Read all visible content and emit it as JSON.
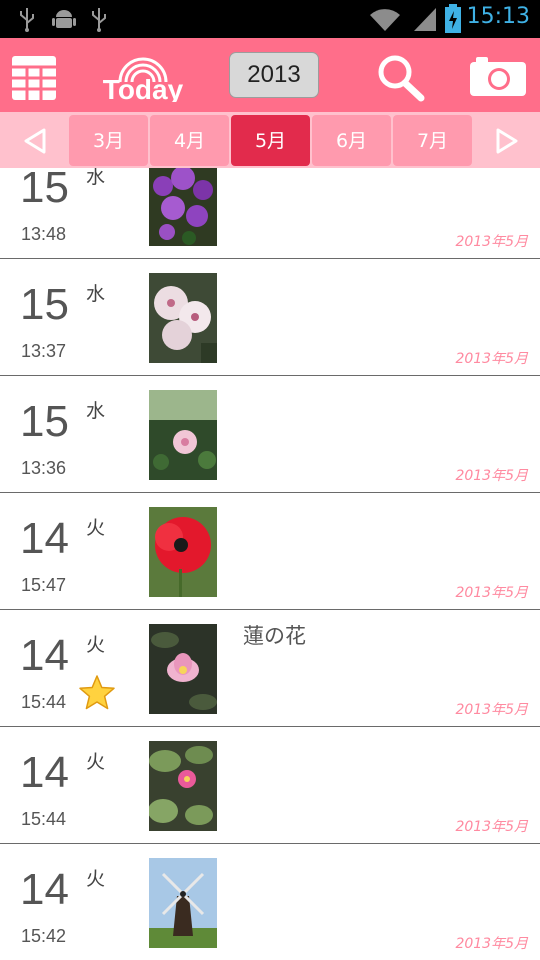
{
  "status_bar": {
    "time": "15:13"
  },
  "header": {
    "year": "2013",
    "logo_text": "Today"
  },
  "months": {
    "tabs": [
      "3月",
      "4月",
      "5月",
      "6月",
      "7月"
    ],
    "active_index": 2
  },
  "entries": [
    {
      "day": "15",
      "weekday": "水",
      "time": "13:48",
      "memo": "",
      "month_label": "2013年5月",
      "starred": false,
      "photo": "purple-flowers-photo"
    },
    {
      "day": "15",
      "weekday": "水",
      "time": "13:37",
      "memo": "",
      "month_label": "2013年5月",
      "starred": false,
      "photo": "white-rhododendron-photo"
    },
    {
      "day": "15",
      "weekday": "水",
      "time": "13:36",
      "memo": "",
      "month_label": "2013年5月",
      "starred": false,
      "photo": "pink-flower-photo"
    },
    {
      "day": "14",
      "weekday": "火",
      "time": "15:47",
      "memo": "",
      "month_label": "2013年5月",
      "starred": false,
      "photo": "red-poppy-photo"
    },
    {
      "day": "14",
      "weekday": "火",
      "time": "15:44",
      "memo": "蓮の花",
      "month_label": "2013年5月",
      "starred": true,
      "photo": "lotus-flower-photo"
    },
    {
      "day": "14",
      "weekday": "火",
      "time": "15:44",
      "memo": "",
      "month_label": "2013年5月",
      "starred": false,
      "photo": "lotus-leaves-photo"
    },
    {
      "day": "14",
      "weekday": "火",
      "time": "15:42",
      "memo": "",
      "month_label": "2013年5月",
      "starred": false,
      "photo": "windmill-photo"
    }
  ],
  "colors": {
    "header": "#ff6e8a",
    "month_bar": "#ffc1cd",
    "month_tab": "#ff9aae",
    "month_tab_active": "#e22b4c",
    "month_label": "#ff8aa0"
  }
}
